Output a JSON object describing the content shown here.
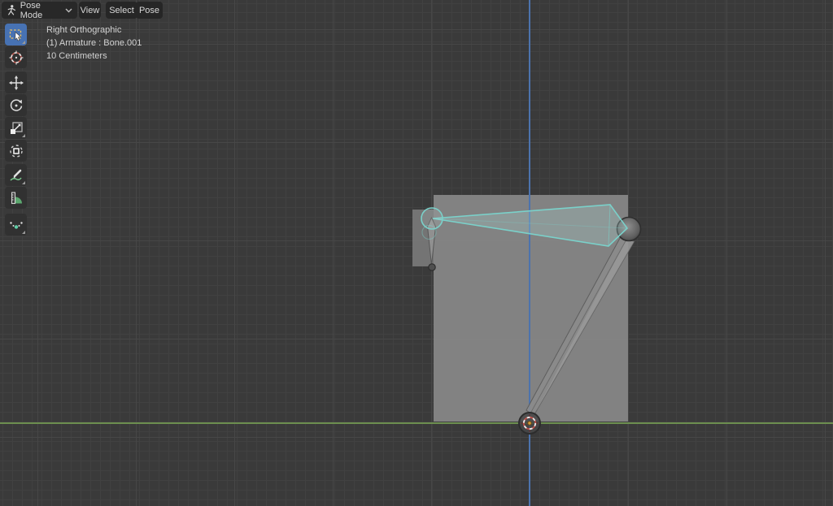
{
  "header": {
    "mode_selector": {
      "label": "Pose Mode",
      "icon": "pose-figure-icon"
    },
    "menus": [
      {
        "label": "View"
      },
      {
        "label": "Select"
      },
      {
        "label": "Pose"
      }
    ]
  },
  "viewport_overlay": {
    "view_name": "Right Orthographic",
    "active_object": "(1) Armature : Bone.001",
    "grid_scale": "10 Centimeters"
  },
  "toolbar": {
    "tools": [
      {
        "name": "Select Box",
        "icon": "select-box-icon",
        "active": true
      },
      {
        "name": "Cursor",
        "icon": "cursor-tool-icon",
        "active": false
      },
      {
        "name": "Move",
        "icon": "move-icon",
        "active": false
      },
      {
        "name": "Rotate",
        "icon": "rotate-icon",
        "active": false
      },
      {
        "name": "Scale",
        "icon": "scale-icon",
        "active": false
      },
      {
        "name": "Transform",
        "icon": "transform-icon",
        "active": false
      },
      {
        "name": "Annotate",
        "icon": "annotate-icon",
        "active": false
      },
      {
        "name": "Measure",
        "icon": "measure-icon",
        "active": false
      },
      {
        "name": "Pose Breakdowner",
        "icon": "breakdowner-icon",
        "active": false
      }
    ]
  },
  "scene": {
    "selected_bone": "Bone.001",
    "armature": "Armature",
    "elements": [
      "selected-bone",
      "lower-bone",
      "small-bone",
      "joint-sphere",
      "3d-cursor"
    ]
  },
  "theme": {
    "accent_blue": "#4772b3",
    "bone_select_color": "#7ad1ca",
    "axis_z_color": "#4c73ad",
    "axis_y_color": "#6c8f4f",
    "background": "#3a3a3a",
    "mesh_gray": "#858585"
  }
}
